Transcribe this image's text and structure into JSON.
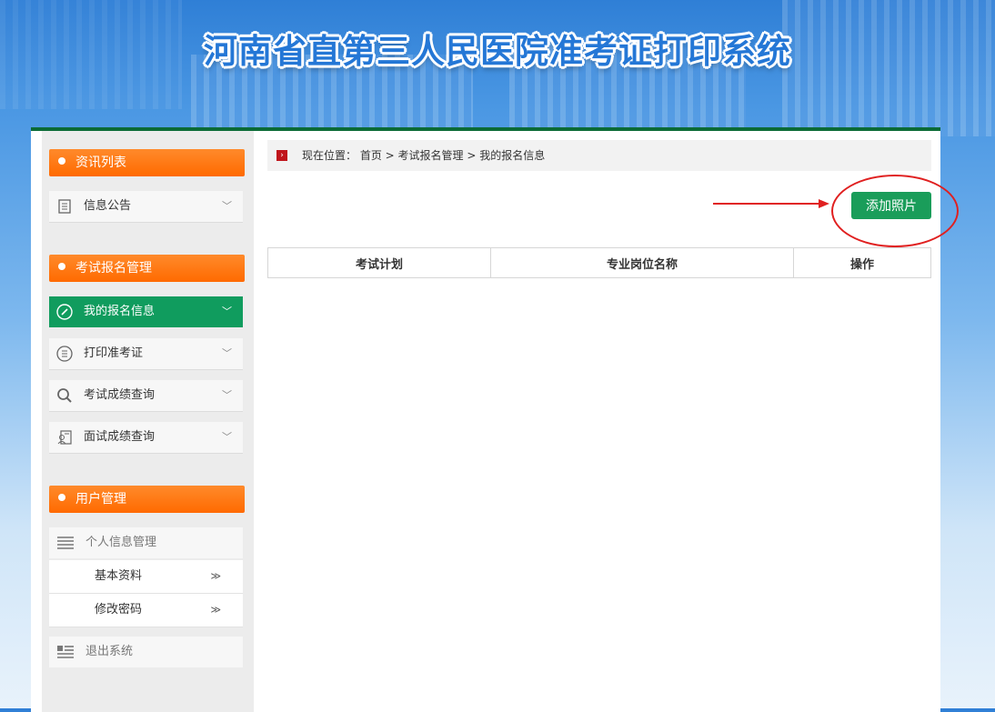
{
  "site": {
    "title": "河南省直第三人民医院准考证打印系统"
  },
  "sidebar": {
    "sections": [
      {
        "title": "资讯列表"
      },
      {
        "title": "考试报名管理"
      },
      {
        "title": "用户管理"
      }
    ],
    "news_items": [
      {
        "label": "信息公告",
        "icon": "document-icon"
      }
    ],
    "exam_items": [
      {
        "label": "我的报名信息",
        "icon": "pencil-circle-icon",
        "active": true
      },
      {
        "label": "打印准考证",
        "icon": "list-circle-icon"
      },
      {
        "label": "考试成绩查询",
        "icon": "search-icon"
      },
      {
        "label": "面试成绩查询",
        "icon": "person-document-icon"
      }
    ],
    "user": {
      "personal_info": "个人信息管理",
      "sub_items": [
        {
          "label": "基本资料"
        },
        {
          "label": "修改密码"
        }
      ],
      "logout": "退出系统"
    },
    "chevron_glyph": "≫",
    "down_glyph": "﹀"
  },
  "breadcrumb": {
    "prefix": "现在位置：",
    "path": "首页 > 考试报名管理 > 我的报名信息"
  },
  "actions": {
    "add_photo": "添加照片"
  },
  "table": {
    "columns": [
      "考试计划",
      "专业岗位名称",
      "操作"
    ],
    "rows": []
  },
  "colors": {
    "accent_green": "#109c5e",
    "section_orange": "#ff7a10",
    "annotation_red": "#e02020"
  }
}
